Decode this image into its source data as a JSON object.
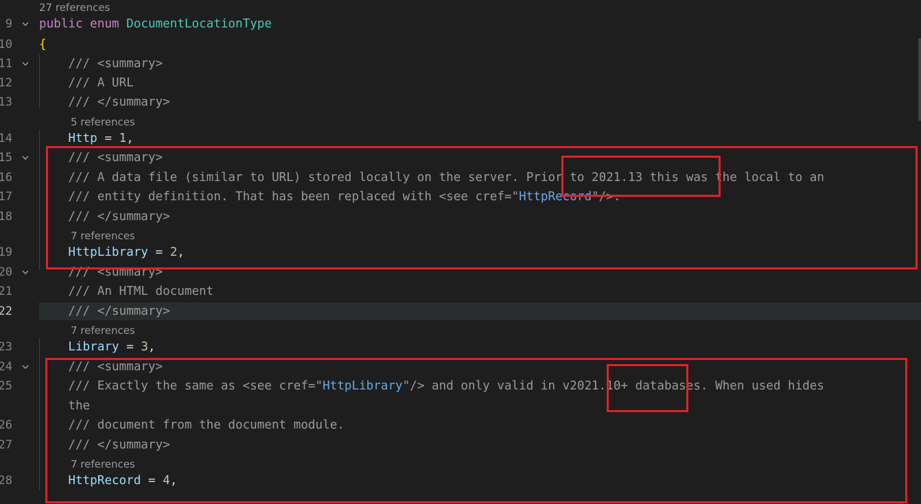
{
  "editor": {
    "lines": [
      {
        "num": "9",
        "lens": "27 references",
        "tokens": [
          [
            "public",
            "kw2"
          ],
          [
            " "
          ],
          [
            "enum",
            "kw2"
          ],
          [
            " "
          ],
          [
            "DocumentLocationType",
            "typ"
          ]
        ],
        "fold": true
      },
      {
        "num": "10",
        "tokens": [
          [
            "{",
            "brace"
          ]
        ]
      },
      {
        "num": "11",
        "tokens": [
          [
            "    "
          ],
          [
            "/// <summary>",
            "doc"
          ]
        ],
        "fold": true
      },
      {
        "num": "12",
        "tokens": [
          [
            "    "
          ],
          [
            "/// A URL",
            "doc"
          ]
        ]
      },
      {
        "num": "13",
        "tokens": [
          [
            "    "
          ],
          [
            "/// </summary>",
            "doc"
          ]
        ]
      },
      {
        "num": "14",
        "lens": "5 references",
        "tokens": [
          [
            "    "
          ],
          [
            "Http",
            "ident"
          ],
          [
            " = "
          ],
          [
            "1",
            "num"
          ],
          [
            ","
          ]
        ]
      },
      {
        "num": "15",
        "tokens": [
          [
            "    "
          ],
          [
            "/// <summary>",
            "doc"
          ]
        ],
        "fold": true
      },
      {
        "num": "16",
        "tokens": [
          [
            "    "
          ],
          [
            "/// A data file (similar to URL) stored locally on the server. Prior to 2021.13 this was the local to an",
            "doc"
          ]
        ]
      },
      {
        "num": "17",
        "tokens": [
          [
            "    "
          ],
          [
            "/// entity definition. That has been replaced with <see cref=\"",
            "doc"
          ],
          [
            "HttpRecord",
            "cref"
          ],
          [
            "\"/>.",
            "doc"
          ]
        ]
      },
      {
        "num": "18",
        "tokens": [
          [
            "    "
          ],
          [
            "/// </summary>",
            "doc"
          ]
        ]
      },
      {
        "num": "19",
        "lens": "7 references",
        "tokens": [
          [
            "    "
          ],
          [
            "HttpLibrary",
            "ident"
          ],
          [
            " = "
          ],
          [
            "2",
            "num"
          ],
          [
            ","
          ]
        ]
      },
      {
        "num": "20",
        "tokens": [
          [
            "    "
          ],
          [
            "/// <summary>",
            "doc"
          ]
        ],
        "fold": true
      },
      {
        "num": "21",
        "tokens": [
          [
            "    "
          ],
          [
            "/// An HTML document",
            "doc"
          ]
        ]
      },
      {
        "num": "22",
        "tokens": [
          [
            "    "
          ],
          [
            "/// </summary>",
            "doc"
          ]
        ],
        "current": true
      },
      {
        "num": "23",
        "lens": "7 references",
        "tokens": [
          [
            "    "
          ],
          [
            "Library",
            "ident"
          ],
          [
            " = "
          ],
          [
            "3",
            "num"
          ],
          [
            ","
          ]
        ]
      },
      {
        "num": "24",
        "tokens": [
          [
            "    "
          ],
          [
            "/// <summary>",
            "doc"
          ]
        ],
        "fold": true
      },
      {
        "num": "25",
        "tokens": [
          [
            "    "
          ],
          [
            "/// Exactly the same as <see cref=\"",
            "doc"
          ],
          [
            "HttpLibrary",
            "cref"
          ],
          [
            "\"/> and only valid in v2021.10+ databases. When used hides",
            "doc"
          ]
        ]
      },
      {
        "num": "",
        "tokens": [
          [
            "    "
          ],
          [
            "the",
            "doc"
          ]
        ]
      },
      {
        "num": "26",
        "tokens": [
          [
            "    "
          ],
          [
            "/// document from the document module.",
            "doc"
          ]
        ]
      },
      {
        "num": "27",
        "tokens": [
          [
            "    "
          ],
          [
            "/// </summary>",
            "doc"
          ]
        ]
      },
      {
        "num": "28",
        "lens": "7 references",
        "tokens": [
          [
            "    "
          ],
          [
            "HttpRecord",
            "ident"
          ],
          [
            " = "
          ],
          [
            "4",
            "num"
          ],
          [
            ","
          ]
        ]
      }
    ]
  },
  "colors": {
    "highlight": "#e3202a",
    "background": "#1e1e1e"
  }
}
